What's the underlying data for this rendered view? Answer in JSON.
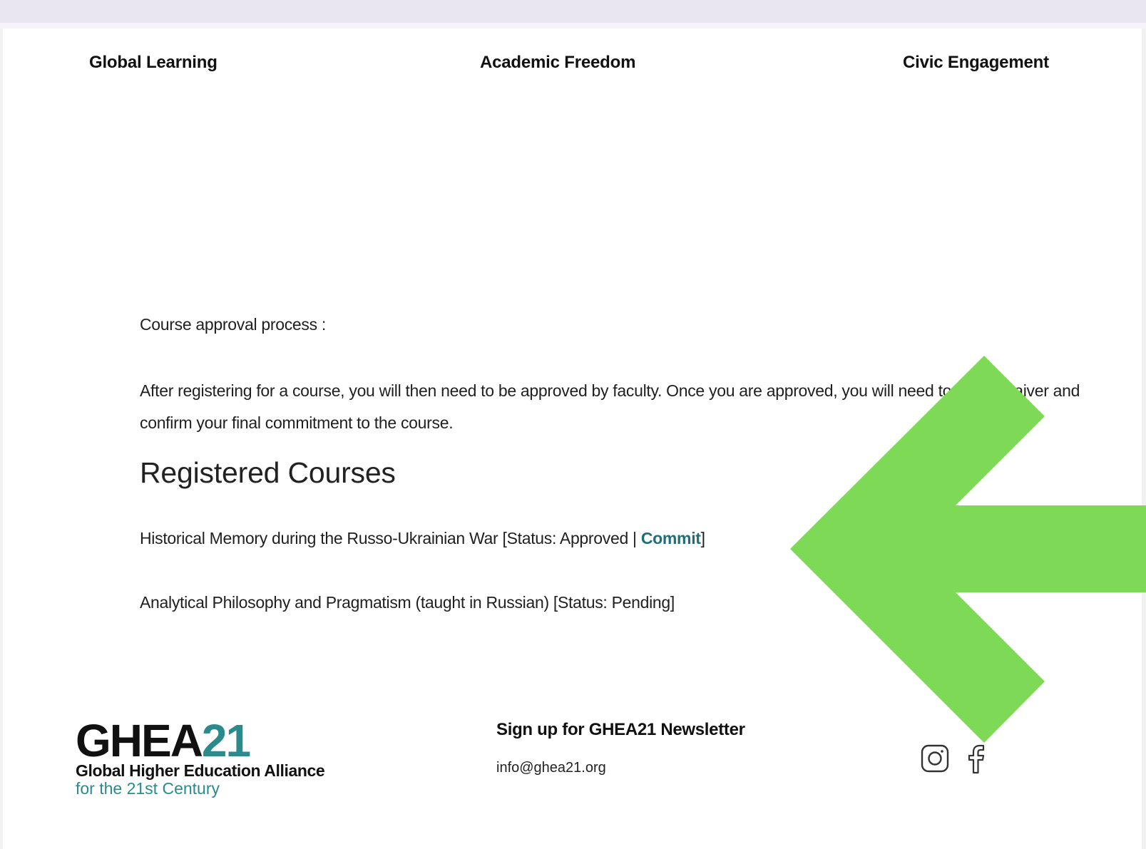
{
  "nav": {
    "items": [
      {
        "label": "Global Learning"
      },
      {
        "label": "Academic Freedom"
      },
      {
        "label": "Civic Engagement"
      }
    ]
  },
  "main": {
    "process_title": "Course approval process :",
    "process_description": "After registering for a course, you will then need to be approved by faculty. Once you are approved, you will need to sign a waiver and confirm your final commitment to the course.",
    "section_heading": "Registered Courses",
    "courses": [
      {
        "title": "Historical Memory during the Russo-Ukrainian War [Status: Approved | ",
        "action_label": "Commit",
        "suffix": "]"
      },
      {
        "title": "Analytical Philosophy and Pragmatism (taught in Russian) [Status: Pending]"
      }
    ]
  },
  "footer": {
    "logo": {
      "mark_letters": "GHEA",
      "mark_number": "21",
      "line1": "Global Higher Education Alliance",
      "line2": "for the 21st Century"
    },
    "newsletter_title": "Sign up for GHEA21 Newsletter",
    "email": "info@ghea21.org",
    "social": [
      "instagram-icon",
      "facebook-icon"
    ]
  },
  "colors": {
    "accent": "#1f6f74",
    "logo_teal": "#2a8a8c",
    "arrow": "#7ed957",
    "top_band": "#e9e6ef"
  },
  "overlay": {
    "icon": "arrow-left-icon",
    "points_to": "Commit"
  }
}
